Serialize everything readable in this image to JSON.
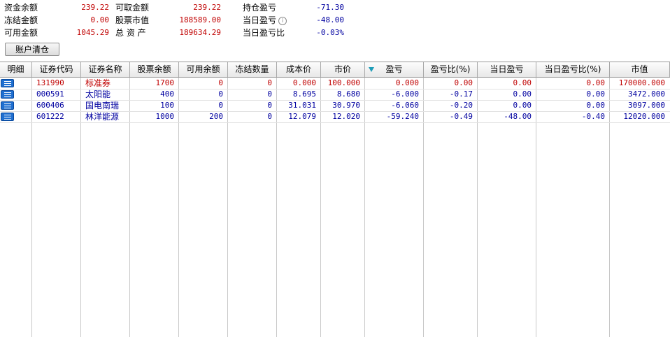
{
  "summary": {
    "fund_balance_label": "资金余额",
    "fund_balance": "239.22",
    "withdrawable_label": "可取金额",
    "withdrawable": "239.22",
    "position_pl_label": "持仓盈亏",
    "position_pl": "-71.30",
    "frozen_label": "冻结金额",
    "frozen": "0.00",
    "stock_value_label": "股票市值",
    "stock_value": "188589.00",
    "today_pl_label": "当日盈亏",
    "today_pl": "-48.00",
    "available_label": "可用金额",
    "available": "1045.29",
    "total_assets_label": "总 资 产",
    "total_assets": "189634.29",
    "today_pl_ratio_label": "当日盈亏比",
    "today_pl_ratio": "-0.03%",
    "info_icon": "info-icon"
  },
  "clear_account_label": "账户清仓",
  "table": {
    "columns": [
      "明细",
      "证券代码",
      "证券名称",
      "股票余额",
      "可用余额",
      "冻结数量",
      "成本价",
      "市价",
      "盈亏",
      "盈亏比(%)",
      "当日盈亏",
      "当日盈亏比(%)",
      "市值"
    ],
    "sort_column": "盈亏",
    "rows": [
      {
        "code": "131990",
        "name": "标准券",
        "balance": "1700",
        "available": "0",
        "frozen": "0",
        "cost": "0.000",
        "price": "100.000",
        "pl": "0.000",
        "pl_ratio": "0.00",
        "today_pl": "0.00",
        "today_ratio": "0.00",
        "market_value": "170000.000",
        "color": "red"
      },
      {
        "code": "000591",
        "name": "太阳能",
        "balance": "400",
        "available": "0",
        "frozen": "0",
        "cost": "8.695",
        "price": "8.680",
        "pl": "-6.000",
        "pl_ratio": "-0.17",
        "today_pl": "0.00",
        "today_ratio": "0.00",
        "market_value": "3472.000",
        "color": "blue"
      },
      {
        "code": "600406",
        "name": "国电南瑞",
        "balance": "100",
        "available": "0",
        "frozen": "0",
        "cost": "31.031",
        "price": "30.970",
        "pl": "-6.060",
        "pl_ratio": "-0.20",
        "today_pl": "0.00",
        "today_ratio": "0.00",
        "market_value": "3097.000",
        "color": "blue"
      },
      {
        "code": "601222",
        "name": "林洋能源",
        "balance": "1000",
        "available": "200",
        "frozen": "0",
        "cost": "12.079",
        "price": "12.020",
        "pl": "-59.240",
        "pl_ratio": "-0.49",
        "today_pl": "-48.00",
        "today_ratio": "-0.40",
        "market_value": "12020.000",
        "color": "blue"
      }
    ]
  },
  "colors": {
    "positive": "#c00000",
    "negative": "#0000a0",
    "detail_button": "#1f6fd0",
    "sort_indicator": "#1e9db8"
  }
}
